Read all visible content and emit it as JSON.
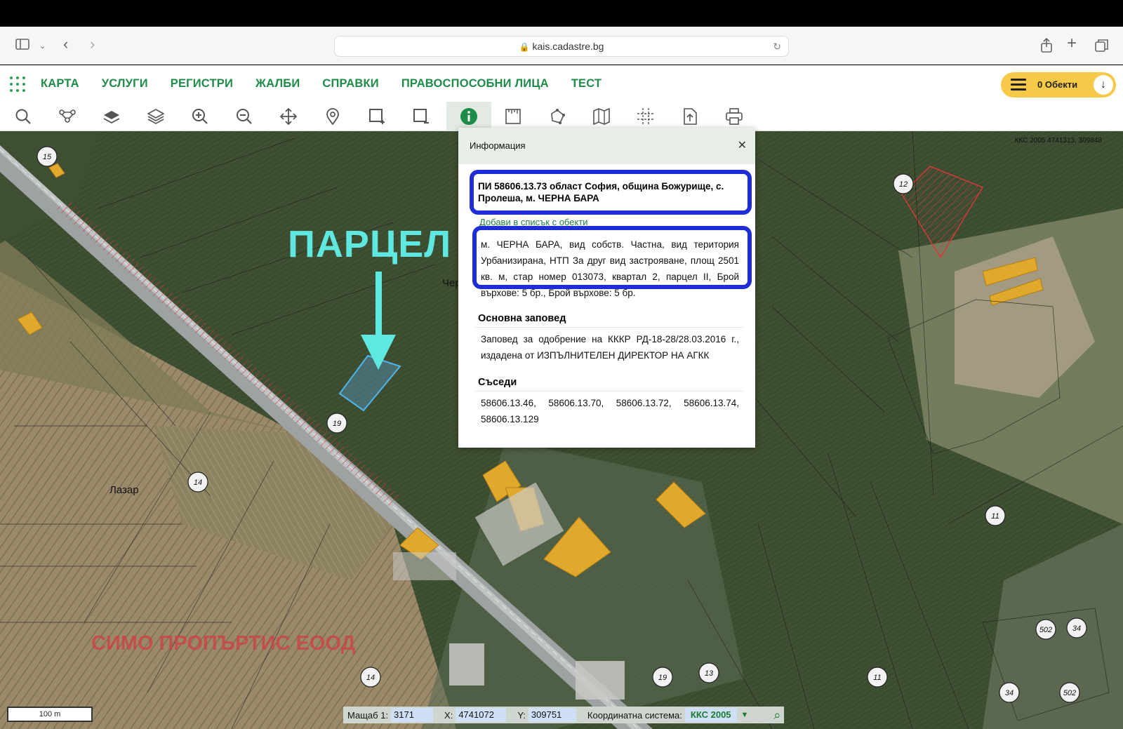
{
  "browser": {
    "url": "kais.cadastre.bg"
  },
  "nav": {
    "items": [
      "КАРТА",
      "УСЛУГИ",
      "РЕГИСТРИ",
      "ЖАЛБИ",
      "СПРАВКИ",
      "ПРАВОСПОСОБНИ ЛИЦА",
      "ТЕСТ"
    ],
    "objects_label": "0 Обекти"
  },
  "toolbar": {
    "tools": [
      "search-icon",
      "tree-icon",
      "layer-icon",
      "layers-icon",
      "zoom-in-icon",
      "zoom-out-icon",
      "pan-icon",
      "pin-icon",
      "select-add-icon",
      "select-remove-icon",
      "info-icon",
      "measure-icon",
      "polygon-icon",
      "map-icon",
      "grid-icon",
      "export-icon",
      "print-icon"
    ],
    "active": "info-icon"
  },
  "map": {
    "coord_top": "ККС 2005 4741313, 309848",
    "overlay_label": "ПАРЦЕЛ",
    "place_lazar": "Лазар",
    "place_cher": "Чер",
    "watermark": "СИМО ПРОПЪРТИС ЕООД",
    "scale_bar": "100 m",
    "circles": [
      "15",
      "12",
      "19",
      "14",
      "11",
      "14",
      "19",
      "13",
      "11",
      "502",
      "34",
      "34",
      "502"
    ]
  },
  "status": {
    "scale_label": "Мащаб 1:",
    "scale_value": "3171",
    "x_label": "X:",
    "x_value": "4741072",
    "y_label": "Y:",
    "y_value": "309751",
    "sys_label": "Координатна система:",
    "sys_value": "ККС 2005"
  },
  "panel": {
    "header": "Информация",
    "title": "ПИ 58606.13.73 област София, община Божурище, с. Пролеша, м. ЧЕРНА БАРА",
    "add_link": "Добави в списък с обекти",
    "description": "м. ЧЕРНА БАРА, вид собств. Частна, вид територия Урбанизирана, НТП За друг вид застрояване, площ 2501 кв. м, стар номер 013073, квартал 2, парцел II, Брой върхове: 5 бр., Брой върхове: 5 бр.",
    "order_heading": "Основна заповед",
    "order_text": "Заповед за одобрение на КККР РД-18-28/28.03.2016 г., издадена от ИЗПЪЛНИТЕЛЕН ДИРЕКТОР НА АГКК",
    "neighbors_heading": "Съседи",
    "neighbors_text": "58606.13.46, 58606.13.70, 58606.13.72, 58606.13.74, 58606.13.129"
  },
  "colors": {
    "nav_green": "#1f8b48",
    "highlight_blue": "#1e2dd6",
    "parcel_cyan": "#5fe8e0",
    "objects_yellow": "#f7c948"
  }
}
